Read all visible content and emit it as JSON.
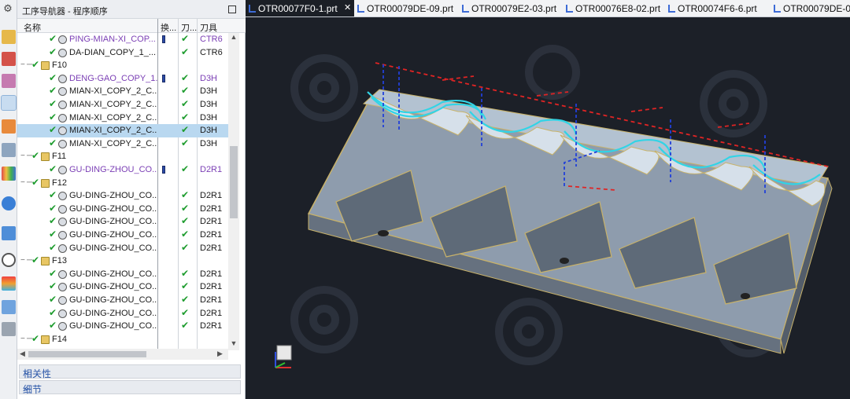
{
  "navigator": {
    "title": "工序导航器 - 程序顺序",
    "columns": {
      "name": "名称",
      "switch": "换...",
      "path": "刀...",
      "tool": "刀具"
    },
    "rows": [
      {
        "label": "PING-MIAN-XI_COP...",
        "type": "op",
        "purple": true,
        "switch": true,
        "path_ok": true,
        "tool": "CTR6",
        "tool_purple": true
      },
      {
        "label": "DA-DIAN_COPY_1_...",
        "type": "op",
        "purple": false,
        "switch": false,
        "path_ok": true,
        "tool": "CTR6",
        "tool_purple": false
      },
      {
        "label": "F10",
        "type": "group",
        "purple": false,
        "switch": false,
        "path_ok": false,
        "tool": "",
        "tool_purple": false
      },
      {
        "label": "DENG-GAO_COPY_1...",
        "type": "op",
        "purple": true,
        "switch": true,
        "path_ok": true,
        "tool": "D3H",
        "tool_purple": true
      },
      {
        "label": "MIAN-XI_COPY_2_C...",
        "type": "op",
        "purple": false,
        "switch": false,
        "path_ok": true,
        "tool": "D3H",
        "tool_purple": false
      },
      {
        "label": "MIAN-XI_COPY_2_C...",
        "type": "op",
        "purple": false,
        "switch": false,
        "path_ok": true,
        "tool": "D3H",
        "tool_purple": false
      },
      {
        "label": "MIAN-XI_COPY_2_C...",
        "type": "op",
        "purple": false,
        "switch": false,
        "path_ok": true,
        "tool": "D3H",
        "tool_purple": false
      },
      {
        "label": "MIAN-XI_COPY_2_C...",
        "type": "op",
        "purple": false,
        "switch": false,
        "path_ok": true,
        "tool": "D3H",
        "tool_purple": false,
        "selected": true
      },
      {
        "label": "MIAN-XI_COPY_2_C...",
        "type": "op",
        "purple": false,
        "switch": false,
        "path_ok": true,
        "tool": "D3H",
        "tool_purple": false
      },
      {
        "label": "F11",
        "type": "group",
        "purple": false,
        "switch": false,
        "path_ok": false,
        "tool": "",
        "tool_purple": false
      },
      {
        "label": "GU-DING-ZHOU_CO...",
        "type": "op",
        "purple": true,
        "switch": true,
        "path_ok": true,
        "tool": "D2R1",
        "tool_purple": true
      },
      {
        "label": "F12",
        "type": "group",
        "purple": false,
        "switch": false,
        "path_ok": false,
        "tool": "",
        "tool_purple": false
      },
      {
        "label": "GU-DING-ZHOU_CO...",
        "type": "op",
        "purple": false,
        "switch": false,
        "path_ok": true,
        "tool": "D2R1",
        "tool_purple": false
      },
      {
        "label": "GU-DING-ZHOU_CO...",
        "type": "op",
        "purple": false,
        "switch": false,
        "path_ok": true,
        "tool": "D2R1",
        "tool_purple": false
      },
      {
        "label": "GU-DING-ZHOU_CO...",
        "type": "op",
        "purple": false,
        "switch": false,
        "path_ok": true,
        "tool": "D2R1",
        "tool_purple": false
      },
      {
        "label": "GU-DING-ZHOU_CO...",
        "type": "op",
        "purple": false,
        "switch": false,
        "path_ok": true,
        "tool": "D2R1",
        "tool_purple": false
      },
      {
        "label": "GU-DING-ZHOU_CO...",
        "type": "op",
        "purple": false,
        "switch": false,
        "path_ok": true,
        "tool": "D2R1",
        "tool_purple": false
      },
      {
        "label": "F13",
        "type": "group",
        "purple": false,
        "switch": false,
        "path_ok": false,
        "tool": "",
        "tool_purple": false
      },
      {
        "label": "GU-DING-ZHOU_CO...",
        "type": "op",
        "purple": false,
        "switch": false,
        "path_ok": true,
        "tool": "D2R1",
        "tool_purple": false
      },
      {
        "label": "GU-DING-ZHOU_CO...",
        "type": "op",
        "purple": false,
        "switch": false,
        "path_ok": true,
        "tool": "D2R1",
        "tool_purple": false
      },
      {
        "label": "GU-DING-ZHOU_CO...",
        "type": "op",
        "purple": false,
        "switch": false,
        "path_ok": true,
        "tool": "D2R1",
        "tool_purple": false
      },
      {
        "label": "GU-DING-ZHOU_CO...",
        "type": "op",
        "purple": false,
        "switch": false,
        "path_ok": true,
        "tool": "D2R1",
        "tool_purple": false
      },
      {
        "label": "GU-DING-ZHOU_CO...",
        "type": "op",
        "purple": false,
        "switch": false,
        "path_ok": true,
        "tool": "D2R1",
        "tool_purple": false
      },
      {
        "label": "F14",
        "type": "group",
        "purple": false,
        "switch": false,
        "path_ok": false,
        "tool": "",
        "tool_purple": false
      }
    ],
    "sections": {
      "dependencies": "相关性",
      "details": "细节"
    }
  },
  "tabs": [
    {
      "label": "OTR00077F0-1.prt",
      "active": true
    },
    {
      "label": "OTR00079DE-09.prt",
      "active": false
    },
    {
      "label": "OTR00079E2-03.prt",
      "active": false
    },
    {
      "label": "OTR00076E8-02.prt",
      "active": false
    },
    {
      "label": "OTR00074F6-6.prt",
      "active": false
    },
    {
      "label": "OTR00079DE-05.prt",
      "active": false
    }
  ],
  "icons": {
    "check": "check-icon",
    "group": "program-group-icon",
    "operation": "operation-icon"
  },
  "colors": {
    "check": "#1e9c2e",
    "purple_text": "#7b3fb5",
    "selection": "#b9d8f0",
    "viewport_bg": "#1c2028",
    "toolpath_cyan": "#31d4e6",
    "toolpath_red": "#e02424",
    "toolpath_blue": "#2240d8",
    "part_surface": "#a8b8c8"
  }
}
